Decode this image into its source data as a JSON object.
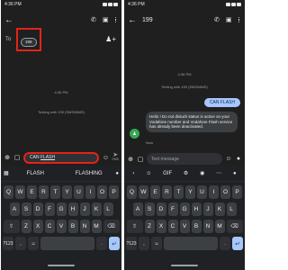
{
  "left": {
    "status_time": "4:36 PM",
    "to_label": "To",
    "recipient_chip": "199",
    "date_stamp": "4:36 PM",
    "texting_with": "Texting with 199 (SMS/MMS)",
    "compose_text_prefix": "CAN ",
    "compose_text_word": "FLASH",
    "send_caption": "SMS",
    "suggestions": [
      "FLASH",
      "FLASHING"
    ]
  },
  "right": {
    "status_time": "4:36 PM",
    "title": "199",
    "date_stamp": "4:36 PM",
    "texting_with": "Texting with 199 (SMS/MMS)",
    "outgoing_message": "CAN FLASH",
    "incoming_message": "Hello ! Do not disturb status is  active on your Vodafone number and Vodafone Flash service has already been deactivated.",
    "incoming_time": "Now",
    "compose_placeholder": "Text message",
    "toolbar_gif": "GIF"
  },
  "keyboard": {
    "row1": [
      "Q",
      "W",
      "E",
      "R",
      "T",
      "Y",
      "U",
      "I",
      "O",
      "P"
    ],
    "row2": [
      "A",
      "S",
      "D",
      "F",
      "G",
      "H",
      "J",
      "K",
      "L"
    ],
    "row3": [
      "Z",
      "X",
      "C",
      "V",
      "B",
      "N",
      "M"
    ],
    "symbols_key": "?123",
    "comma_key": ",",
    "period_key": "."
  },
  "colors": {
    "background": "#1f1f1f",
    "highlight_box": "#e2231a",
    "outgoing_bubble": "#a8c7fa",
    "incoming_bubble": "#3c4043"
  },
  "icons": {
    "back": "arrow-left-icon",
    "phone": "phone-icon",
    "video": "video-icon",
    "more": "more-vert-icon",
    "add_person": "person-add-icon",
    "add": "plus-circle-icon",
    "emoji": "emoji-icon",
    "gallery": "gallery-icon",
    "mic": "mic-icon",
    "send": "send-icon",
    "shift": "shift-icon",
    "backspace": "backspace-icon"
  }
}
